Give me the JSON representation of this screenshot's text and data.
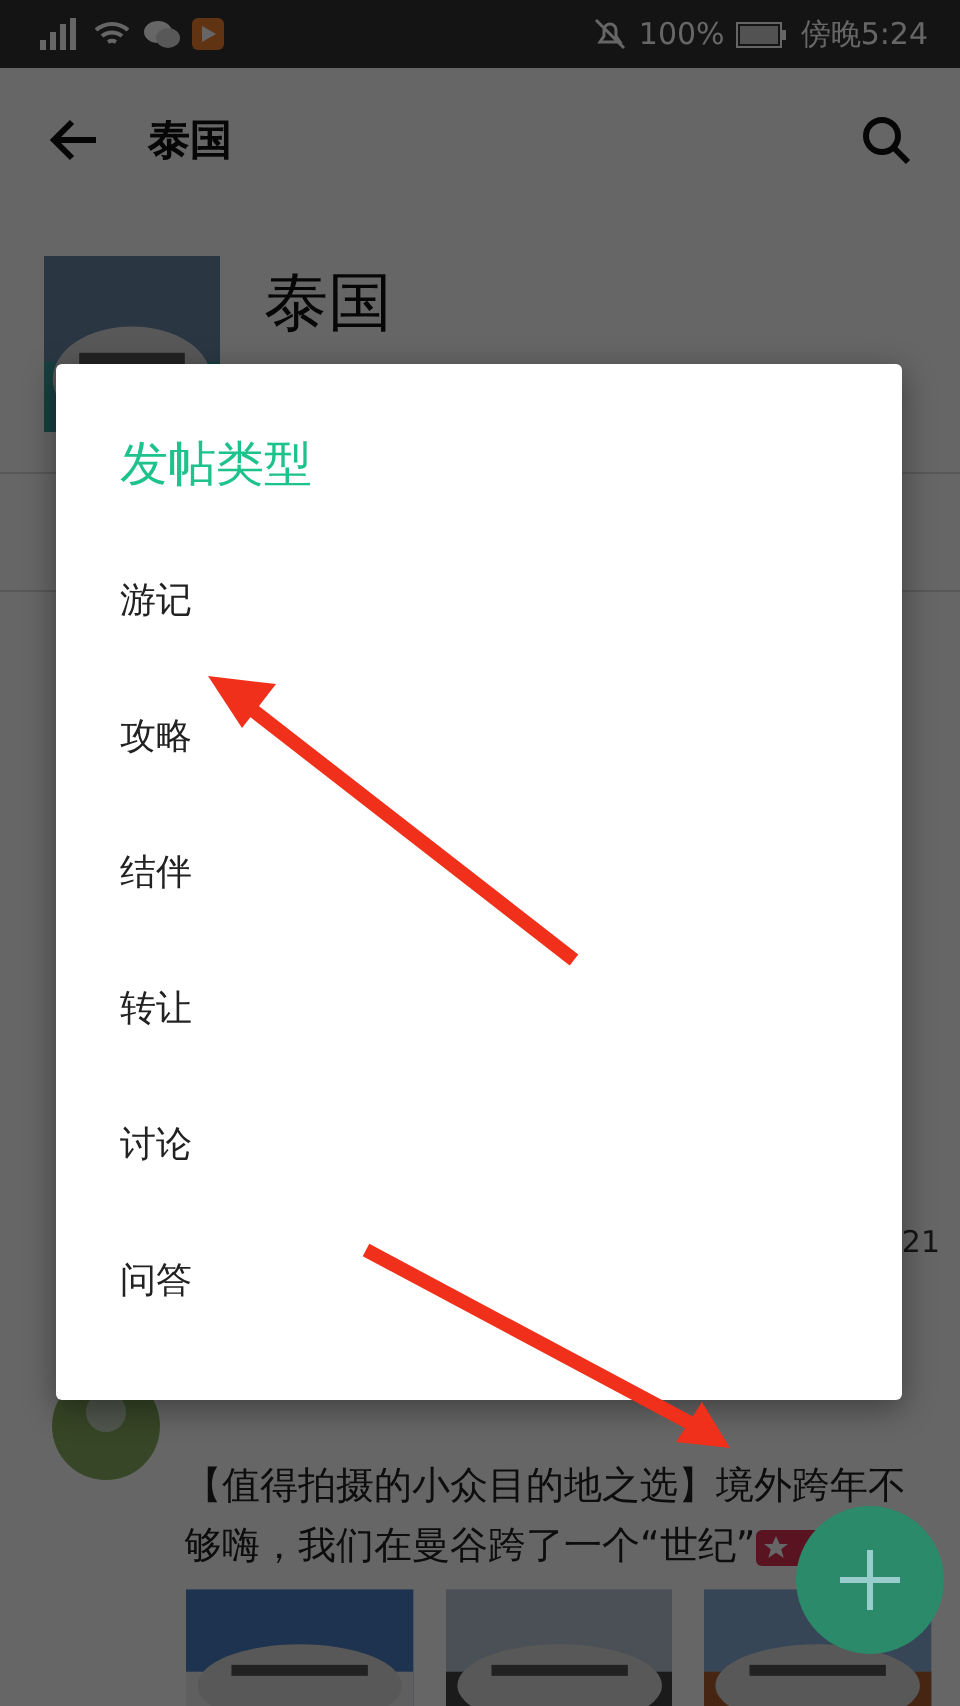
{
  "status_bar": {
    "battery": "100%",
    "time": "傍晚5:24"
  },
  "toolbar": {
    "title": "泰国"
  },
  "header": {
    "name": "泰国"
  },
  "peek": {
    "count": "21"
  },
  "post": {
    "text": "【值得拍摄的小众目的地之选】境外跨年不够嗨，我们在曼谷跨了一个“世纪”"
  },
  "dialog": {
    "title": "发帖类型",
    "options": [
      "游记",
      "攻略",
      "结伴",
      "转让",
      "讨论",
      "问答"
    ]
  }
}
